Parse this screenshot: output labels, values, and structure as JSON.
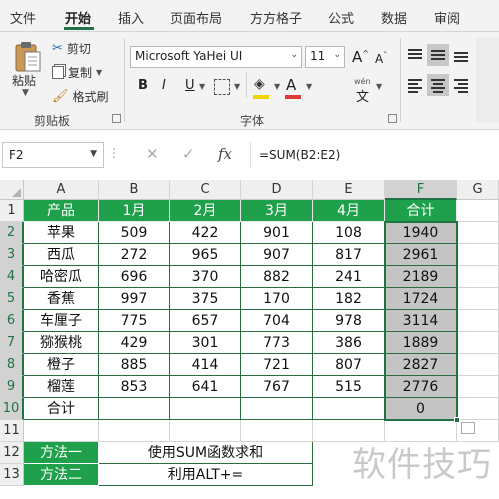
{
  "ribbon_tabs": [
    "文件",
    "开始",
    "插入",
    "页面布局",
    "方方格子",
    "公式",
    "数据",
    "审阅"
  ],
  "active_tab": "开始",
  "clipboard": {
    "paste": "粘贴",
    "cut": "剪切",
    "copy": "复制",
    "format_painter": "格式刷",
    "group_label": "剪贴板"
  },
  "font": {
    "name": "Microsoft YaHei UI",
    "size": "11",
    "grow": "A",
    "shrink": "A",
    "bold": "B",
    "italic": "I",
    "underline": "U",
    "phonetic": "wén",
    "group_label": "字体",
    "font_color": "#e03b3b",
    "highlight_color": "#f2d600"
  },
  "formula_bar": {
    "name_box": "F2",
    "separator": "⋮",
    "formula": "=SUM(B2:E2)"
  },
  "sheet": {
    "columns": [
      "A",
      "B",
      "C",
      "D",
      "E",
      "F",
      "G"
    ],
    "rows": [
      "1",
      "2",
      "3",
      "4",
      "5",
      "6",
      "7",
      "8",
      "9",
      "10",
      "11",
      "12",
      "13"
    ],
    "header": [
      "产品",
      "1月",
      "2月",
      "3月",
      "4月",
      "合计"
    ],
    "data": [
      [
        "苹果",
        "509",
        "422",
        "901",
        "108",
        "1940"
      ],
      [
        "西瓜",
        "272",
        "965",
        "907",
        "817",
        "2961"
      ],
      [
        "哈密瓜",
        "696",
        "370",
        "882",
        "241",
        "2189"
      ],
      [
        "香蕉",
        "997",
        "375",
        "170",
        "182",
        "1724"
      ],
      [
        "车厘子",
        "775",
        "657",
        "704",
        "978",
        "3114"
      ],
      [
        "猕猴桃",
        "429",
        "301",
        "773",
        "386",
        "1889"
      ],
      [
        "橙子",
        "885",
        "414",
        "721",
        "807",
        "2827"
      ],
      [
        "榴莲",
        "853",
        "641",
        "767",
        "515",
        "2776"
      ],
      [
        "合计",
        "",
        "",
        "",
        "",
        "0"
      ]
    ],
    "methods": [
      {
        "label": "方法一",
        "text": "使用SUM函数求和"
      },
      {
        "label": "方法二",
        "text": "利用ALT+="
      }
    ],
    "accent": "#1fa04a"
  },
  "watermark": "软件技巧"
}
